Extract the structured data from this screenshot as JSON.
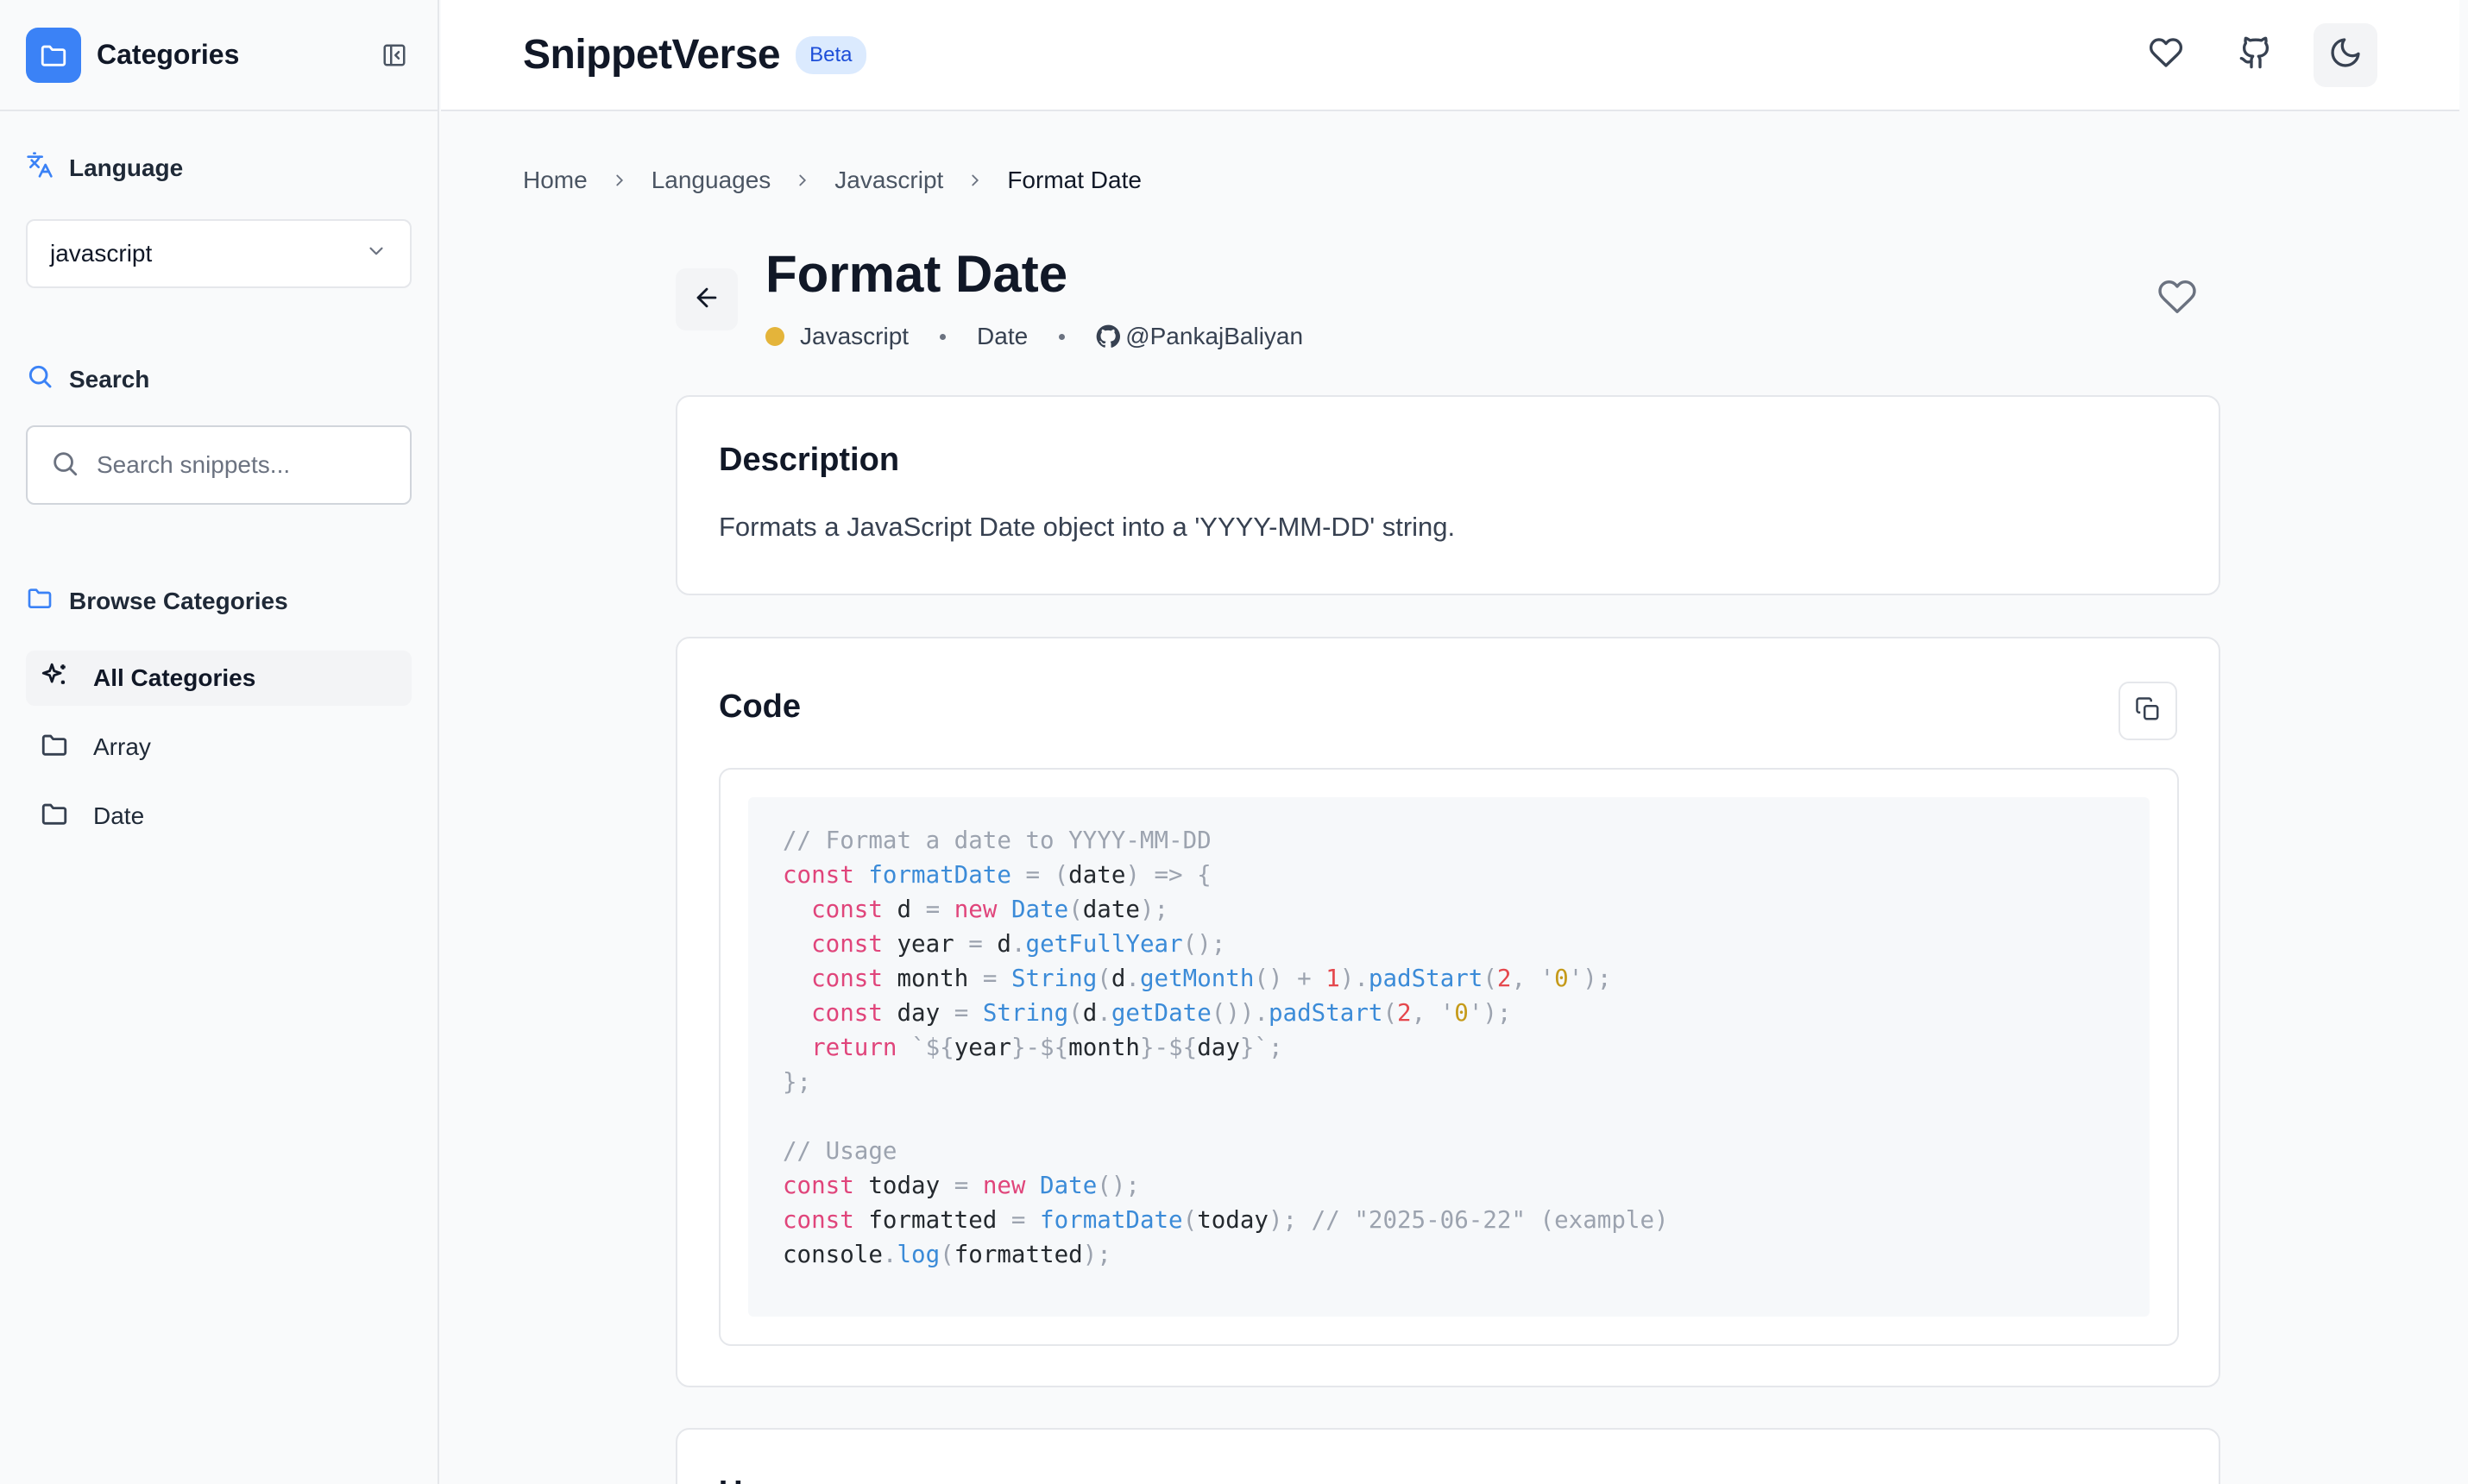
{
  "sidebar": {
    "title": "Categories",
    "language_label": "Language",
    "language_value": "javascript",
    "search_label": "Search",
    "search_placeholder": "Search snippets...",
    "browse_label": "Browse Categories",
    "categories": [
      {
        "label": "All Categories",
        "icon": "sparkles-icon",
        "active": true
      },
      {
        "label": "Array",
        "icon": "folder-icon",
        "active": false
      },
      {
        "label": "Date",
        "icon": "folder-icon",
        "active": false
      }
    ]
  },
  "header": {
    "brand": "SnippetVerse",
    "badge": "Beta",
    "actions": [
      "heart-icon",
      "github-icon",
      "moon-icon"
    ]
  },
  "breadcrumb": [
    "Home",
    "Languages",
    "Javascript",
    "Format Date"
  ],
  "snippet": {
    "title": "Format Date",
    "language": "Javascript",
    "category": "Date",
    "author": "@PankajBaliyan",
    "language_color": "#e4b43a"
  },
  "description": {
    "heading": "Description",
    "text": "Formats a JavaScript Date object into a 'YYYY-MM-DD' string."
  },
  "code": {
    "heading": "Code",
    "lines": [
      [
        [
          "c",
          "// Format a date to YYYY-MM-DD"
        ]
      ],
      [
        [
          "k",
          "const "
        ],
        [
          "f",
          "formatDate"
        ],
        [
          "p",
          " = ("
        ],
        [
          "v",
          "date"
        ],
        [
          "p",
          ") => {"
        ]
      ],
      [
        [
          "v",
          "  "
        ],
        [
          "k",
          "const "
        ],
        [
          "v",
          "d "
        ],
        [
          "p",
          "= "
        ],
        [
          "k",
          "new "
        ],
        [
          "f",
          "Date"
        ],
        [
          "p",
          "("
        ],
        [
          "v",
          "date"
        ],
        [
          "p",
          ");"
        ]
      ],
      [
        [
          "v",
          "  "
        ],
        [
          "k",
          "const "
        ],
        [
          "v",
          "year "
        ],
        [
          "p",
          "= "
        ],
        [
          "v",
          "d"
        ],
        [
          "p",
          "."
        ],
        [
          "f",
          "getFullYear"
        ],
        [
          "p",
          "();"
        ]
      ],
      [
        [
          "v",
          "  "
        ],
        [
          "k",
          "const "
        ],
        [
          "v",
          "month "
        ],
        [
          "p",
          "= "
        ],
        [
          "f",
          "String"
        ],
        [
          "p",
          "("
        ],
        [
          "v",
          "d"
        ],
        [
          "p",
          "."
        ],
        [
          "f",
          "getMonth"
        ],
        [
          "p",
          "() + "
        ],
        [
          "n",
          "1"
        ],
        [
          "p",
          ")."
        ],
        [
          "f",
          "padStart"
        ],
        [
          "p",
          "("
        ],
        [
          "n",
          "2"
        ],
        [
          "p",
          ", '"
        ],
        [
          "s",
          "0"
        ],
        [
          "p",
          "');"
        ]
      ],
      [
        [
          "v",
          "  "
        ],
        [
          "k",
          "const "
        ],
        [
          "v",
          "day "
        ],
        [
          "p",
          "= "
        ],
        [
          "f",
          "String"
        ],
        [
          "p",
          "("
        ],
        [
          "v",
          "d"
        ],
        [
          "p",
          "."
        ],
        [
          "f",
          "getDate"
        ],
        [
          "p",
          "())."
        ],
        [
          "f",
          "padStart"
        ],
        [
          "p",
          "("
        ],
        [
          "n",
          "2"
        ],
        [
          "p",
          ", '"
        ],
        [
          "s",
          "0"
        ],
        [
          "p",
          "');"
        ]
      ],
      [
        [
          "v",
          "  "
        ],
        [
          "k",
          "return "
        ],
        [
          "p",
          "`${"
        ],
        [
          "v",
          "year"
        ],
        [
          "p",
          "}-${"
        ],
        [
          "v",
          "month"
        ],
        [
          "p",
          "}-${"
        ],
        [
          "v",
          "day"
        ],
        [
          "p",
          "}`;"
        ]
      ],
      [
        [
          "p",
          "};"
        ]
      ],
      [
        [
          "v",
          ""
        ]
      ],
      [
        [
          "c",
          "// Usage"
        ]
      ],
      [
        [
          "k",
          "const "
        ],
        [
          "v",
          "today "
        ],
        [
          "p",
          "= "
        ],
        [
          "k",
          "new "
        ],
        [
          "f",
          "Date"
        ],
        [
          "p",
          "();"
        ]
      ],
      [
        [
          "k",
          "const "
        ],
        [
          "v",
          "formatted "
        ],
        [
          "p",
          "= "
        ],
        [
          "f",
          "formatDate"
        ],
        [
          "p",
          "("
        ],
        [
          "v",
          "today"
        ],
        [
          "p",
          "); "
        ],
        [
          "c",
          "// \"2025-06-22\" (example)"
        ]
      ],
      [
        [
          "v",
          "console"
        ],
        [
          "p",
          "."
        ],
        [
          "f",
          "log"
        ],
        [
          "p",
          "("
        ],
        [
          "v",
          "formatted"
        ],
        [
          "p",
          ");"
        ]
      ]
    ]
  },
  "usage": {
    "heading": "Usage"
  }
}
